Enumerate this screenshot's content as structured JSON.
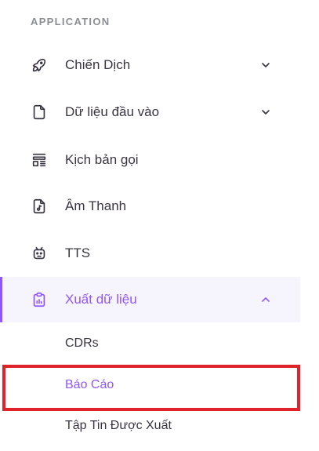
{
  "sidebar": {
    "section_title": "APPLICATION",
    "accent_color": "#9155fd",
    "highlight_color": "#e0222b",
    "items": [
      {
        "label": "Chiến Dịch",
        "icon": "rocket-icon",
        "expandable": true,
        "expanded": false
      },
      {
        "label": "Dữ liệu đầu vào",
        "icon": "file-icon",
        "expandable": true,
        "expanded": false
      },
      {
        "label": "Kịch bản gọi",
        "icon": "script-list-icon",
        "expandable": false
      },
      {
        "label": "Âm Thanh",
        "icon": "audio-file-icon",
        "expandable": false
      },
      {
        "label": "TTS",
        "icon": "robot-icon",
        "expandable": false
      },
      {
        "label": "Xuất dữ liệu",
        "icon": "clipboard-chart-icon",
        "expandable": true,
        "expanded": true,
        "active": true
      }
    ],
    "sub_items": [
      {
        "label": "CDRs"
      },
      {
        "label": "Báo Cáo",
        "selected": true
      },
      {
        "label": "Tập Tin Được Xuất"
      }
    ]
  }
}
